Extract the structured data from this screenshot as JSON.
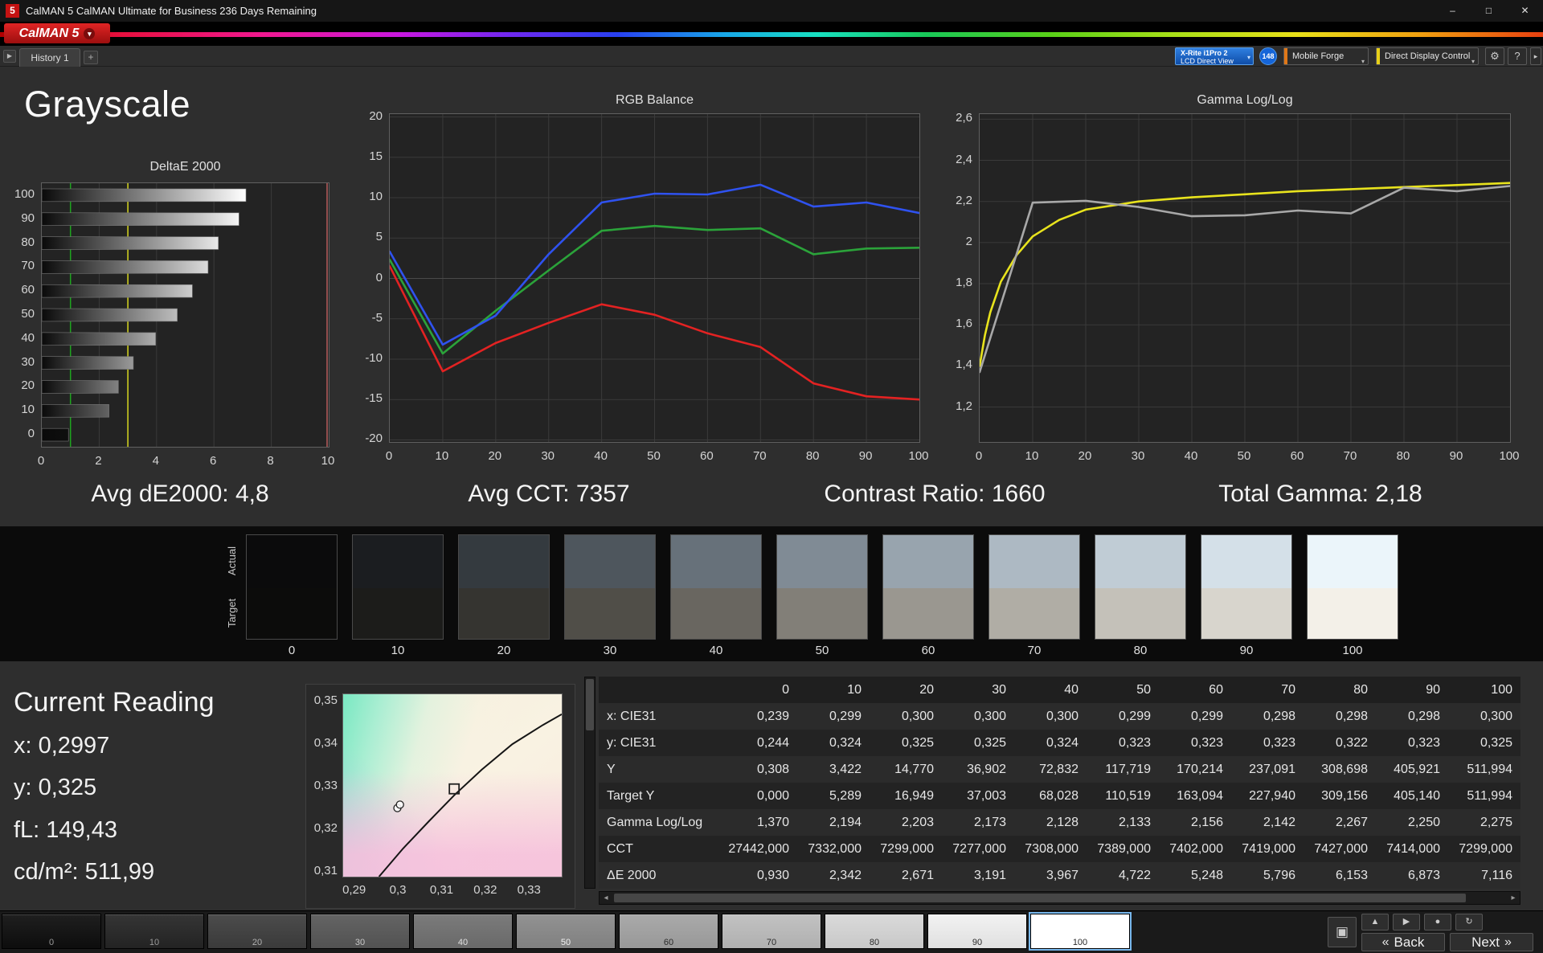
{
  "titlebar": {
    "app_icon": "5",
    "title": "CalMAN 5 CalMAN Ultimate for Business 236 Days Remaining"
  },
  "logo": {
    "text": "CalMAN 5"
  },
  "tabbar": {
    "history_tab": "History 1",
    "add_tab": "+",
    "meter_line1": "X-Rite i1Pro 2",
    "meter_line2": "LCD Direct View",
    "badge": "148",
    "source": "Mobile Forge",
    "display_control": "Direct Display Control"
  },
  "icons": {
    "minimize": "–",
    "maximize": "□",
    "close": "✕",
    "dropdown": "▾",
    "collapse": "▶",
    "gear": "⚙",
    "help": "?",
    "panel": "▸",
    "scroll_left": "◂",
    "scroll_right": "▸",
    "back": "«",
    "next": "»",
    "display_toggle": "▣"
  },
  "page_title": "Grayscale",
  "summary": [
    "Avg dE2000: 4,8",
    "Avg CCT: 7357",
    "Contrast Ratio: 1660",
    "Total Gamma: 2,18"
  ],
  "chart_data": [
    {
      "type": "bar",
      "title": "DeltaE 2000",
      "orientation": "horizontal",
      "categories": [
        "100",
        "90",
        "80",
        "70",
        "60",
        "50",
        "40",
        "30",
        "20",
        "10",
        "0"
      ],
      "values": [
        7.116,
        6.873,
        6.153,
        5.796,
        5.248,
        4.722,
        3.967,
        3.191,
        2.671,
        2.342,
        0.93
      ],
      "xlim": [
        0,
        10
      ],
      "xticks": [
        {
          "v": 0,
          "label": "0"
        },
        {
          "v": 2,
          "label": "2"
        },
        {
          "v": 4,
          "label": "4"
        },
        {
          "v": 6,
          "label": "6"
        },
        {
          "v": 8,
          "label": "8"
        },
        {
          "v": 10,
          "label": "10"
        }
      ],
      "reference_lines": [
        {
          "v": 1,
          "color": "#1fa41f"
        },
        {
          "v": 3,
          "color": "#d8d820"
        },
        {
          "v": 10,
          "color": "#b85c5c"
        }
      ]
    },
    {
      "type": "line",
      "title": "RGB Balance",
      "x": [
        0,
        10,
        20,
        30,
        40,
        50,
        60,
        70,
        80,
        90,
        100
      ],
      "xticks": [
        {
          "v": 0,
          "label": "0"
        },
        {
          "v": 10,
          "label": "10"
        },
        {
          "v": 20,
          "label": "20"
        },
        {
          "v": 30,
          "label": "30"
        },
        {
          "v": 40,
          "label": "40"
        },
        {
          "v": 50,
          "label": "50"
        },
        {
          "v": 60,
          "label": "60"
        },
        {
          "v": 70,
          "label": "70"
        },
        {
          "v": 80,
          "label": "80"
        },
        {
          "v": 90,
          "label": "90"
        },
        {
          "v": 100,
          "label": "100"
        }
      ],
      "ylim": [
        -20.25,
        20.35
      ],
      "yticks": [
        {
          "v": 20,
          "label": "20"
        },
        {
          "v": 15,
          "label": "15"
        },
        {
          "v": 10,
          "label": "10"
        },
        {
          "v": 5,
          "label": "5"
        },
        {
          "v": 0,
          "label": "0"
        },
        {
          "v": -5,
          "label": "-5"
        },
        {
          "v": -10,
          "label": "-10"
        },
        {
          "v": -15,
          "label": "-15"
        },
        {
          "v": -20,
          "label": "-20"
        }
      ],
      "series": [
        {
          "name": "red",
          "color": "#e32222",
          "values": [
            1.5,
            -11.5,
            -8.0,
            -5.5,
            -3.2,
            -4.5,
            -6.8,
            -8.5,
            -13.0,
            -14.6,
            -15.0
          ]
        },
        {
          "name": "green",
          "color": "#2ba33a",
          "values": [
            2.3,
            -9.3,
            -4.0,
            1.0,
            5.9,
            6.5,
            6.0,
            6.2,
            3.0,
            3.7,
            3.8
          ]
        },
        {
          "name": "blue",
          "color": "#2f52ef",
          "values": [
            3.3,
            -8.2,
            -4.6,
            3.0,
            9.4,
            10.5,
            10.4,
            11.6,
            8.9,
            9.4,
            8.1
          ]
        }
      ]
    },
    {
      "type": "line",
      "title": "Gamma Log/Log",
      "x": [
        0,
        10,
        20,
        30,
        40,
        50,
        60,
        70,
        80,
        90,
        100
      ],
      "xticks": [
        {
          "v": 0,
          "label": "0"
        },
        {
          "v": 10,
          "label": "10"
        },
        {
          "v": 20,
          "label": "20"
        },
        {
          "v": 30,
          "label": "30"
        },
        {
          "v": 40,
          "label": "40"
        },
        {
          "v": 50,
          "label": "50"
        },
        {
          "v": 60,
          "label": "60"
        },
        {
          "v": 70,
          "label": "70"
        },
        {
          "v": 80,
          "label": "80"
        },
        {
          "v": 90,
          "label": "90"
        },
        {
          "v": 100,
          "label": "100"
        }
      ],
      "ylim": [
        1.03,
        2.625
      ],
      "yticks": [
        {
          "v": 2.6,
          "label": "2,6"
        },
        {
          "v": 2.4,
          "label": "2,4"
        },
        {
          "v": 2.2,
          "label": "2,2"
        },
        {
          "v": 2.0,
          "label": "2"
        },
        {
          "v": 1.8,
          "label": "1,8"
        },
        {
          "v": 1.6,
          "label": "1,6"
        },
        {
          "v": 1.4,
          "label": "1,4"
        },
        {
          "v": 1.2,
          "label": "1,2"
        }
      ],
      "series": [
        {
          "name": "target",
          "color": "#e8e31d",
          "x": [
            0,
            1,
            2,
            4,
            7,
            10,
            15,
            20,
            30,
            40,
            50,
            60,
            70,
            80,
            90,
            100
          ],
          "values": [
            1.4,
            1.55,
            1.66,
            1.81,
            1.94,
            2.03,
            2.11,
            2.16,
            2.2,
            2.22,
            2.235,
            2.25,
            2.26,
            2.27,
            2.28,
            2.29
          ]
        },
        {
          "name": "measured",
          "color": "#a8a8a8",
          "values": [
            1.37,
            2.194,
            2.203,
            2.173,
            2.128,
            2.133,
            2.156,
            2.142,
            2.267,
            2.25,
            2.275
          ]
        }
      ]
    },
    {
      "type": "scatter",
      "title": "CIE xy",
      "xlim": [
        0.2873,
        0.3373
      ],
      "ylim": [
        0.3089,
        0.3517
      ],
      "xticks": [
        {
          "v": 0.29,
          "label": "0,29"
        },
        {
          "v": 0.3,
          "label": "0,3"
        },
        {
          "v": 0.31,
          "label": "0,31"
        },
        {
          "v": 0.32,
          "label": "0,32"
        },
        {
          "v": 0.33,
          "label": "0,33"
        }
      ],
      "yticks": [
        {
          "v": 0.35,
          "label": "0,35"
        },
        {
          "v": 0.34,
          "label": "0,34"
        },
        {
          "v": 0.33,
          "label": "0,33"
        },
        {
          "v": 0.32,
          "label": "0,32"
        },
        {
          "v": 0.31,
          "label": "0,31"
        }
      ],
      "locus": [
        [
          0.2955,
          0.3089
        ],
        [
          0.301,
          0.3155
        ],
        [
          0.307,
          0.322
        ],
        [
          0.3127,
          0.328
        ],
        [
          0.319,
          0.334
        ],
        [
          0.326,
          0.34
        ],
        [
          0.333,
          0.3445
        ],
        [
          0.3373,
          0.347
        ]
      ],
      "target_marker": {
        "x": 0.3127,
        "y": 0.3295
      },
      "points": [
        {
          "x": 0.2997,
          "y": 0.325
        },
        {
          "x": 0.3003,
          "y": 0.3258
        }
      ]
    }
  ],
  "swatch_strip": {
    "row_labels": [
      "Actual",
      "Target"
    ],
    "levels": [
      "0",
      "10",
      "20",
      "30",
      "40",
      "50",
      "60",
      "70",
      "80",
      "90",
      "100"
    ],
    "actual_colors": [
      "#0b0b0c",
      "#1b1d20",
      "#343a3f",
      "#4e565d",
      "#67717a",
      "#808b95",
      "#98a4ae",
      "#adb9c3",
      "#c0ccd5",
      "#d4e0e8",
      "#ebf5fa"
    ],
    "target_colors": [
      "#0c0c0b",
      "#1c1c1a",
      "#353430",
      "#504e48",
      "#696660",
      "#827f78",
      "#9a9790",
      "#b0ada5",
      "#c4c1b9",
      "#d8d5cd",
      "#f3f0e8"
    ]
  },
  "current_reading": {
    "title": "Current Reading",
    "lines": [
      "x: 0,2997",
      "y: 0,325",
      "fL: 149,43",
      "cd/m²: 511,99"
    ]
  },
  "table": {
    "columns": [
      "0",
      "10",
      "20",
      "30",
      "40",
      "50",
      "60",
      "70",
      "80",
      "90",
      "100"
    ],
    "rows": [
      {
        "label": "x: CIE31",
        "values": [
          "0,239",
          "0,299",
          "0,300",
          "0,300",
          "0,300",
          "0,299",
          "0,299",
          "0,298",
          "0,298",
          "0,298",
          "0,300"
        ]
      },
      {
        "label": "y: CIE31",
        "values": [
          "0,244",
          "0,324",
          "0,325",
          "0,325",
          "0,324",
          "0,323",
          "0,323",
          "0,323",
          "0,322",
          "0,323",
          "0,325"
        ]
      },
      {
        "label": "Y",
        "values": [
          "0,308",
          "3,422",
          "14,770",
          "36,902",
          "72,832",
          "117,719",
          "170,214",
          "237,091",
          "308,698",
          "405,921",
          "511,994"
        ]
      },
      {
        "label": "Target Y",
        "values": [
          "0,000",
          "5,289",
          "16,949",
          "37,003",
          "68,028",
          "110,519",
          "163,094",
          "227,940",
          "309,156",
          "405,140",
          "511,994"
        ]
      },
      {
        "label": "Gamma Log/Log",
        "values": [
          "1,370",
          "2,194",
          "2,203",
          "2,173",
          "2,128",
          "2,133",
          "2,156",
          "2,142",
          "2,267",
          "2,250",
          "2,275"
        ]
      },
      {
        "label": "CCT",
        "values": [
          "27442,000",
          "7332,000",
          "7299,000",
          "7277,000",
          "7308,000",
          "7389,000",
          "7402,000",
          "7419,000",
          "7427,000",
          "7414,000",
          "7299,000"
        ]
      },
      {
        "label": "ΔE 2000",
        "values": [
          "0,930",
          "2,342",
          "2,671",
          "3,191",
          "3,967",
          "4,722",
          "5,248",
          "5,796",
          "6,153",
          "6,873",
          "7,116"
        ]
      }
    ]
  },
  "bottom_bar": {
    "buttons": [
      {
        "label": "0",
        "color": "#0d0d0d",
        "text": "#9a9a9a"
      },
      {
        "label": "10",
        "color": "#232323",
        "text": "#9a9a9a"
      },
      {
        "label": "20",
        "color": "#3a3a3a",
        "text": "#b0b0b0"
      },
      {
        "label": "30",
        "color": "#525252",
        "text": "#c8c8c8"
      },
      {
        "label": "40",
        "color": "#696969",
        "text": "#e0e0e0"
      },
      {
        "label": "50",
        "color": "#808080",
        "text": "#f0f0f0"
      },
      {
        "label": "60",
        "color": "#989898",
        "text": "#2a2a2a"
      },
      {
        "label": "70",
        "color": "#b0b0b0",
        "text": "#2a2a2a"
      },
      {
        "label": "80",
        "color": "#c8c8c8",
        "text": "#2a2a2a"
      },
      {
        "label": "90",
        "color": "#e0e0e0",
        "text": "#2a2a2a"
      },
      {
        "label": "100",
        "color": "#ffffff",
        "text": "#2a2a2a",
        "selected": true
      }
    ],
    "tool_icons": [
      {
        "name": "capture-icon",
        "glyph": "▲"
      },
      {
        "name": "play-icon",
        "glyph": "▶"
      },
      {
        "name": "record-icon",
        "glyph": "●"
      },
      {
        "name": "refresh-icon",
        "glyph": "↻"
      }
    ],
    "nav": {
      "back": "Back",
      "next": "Next"
    }
  }
}
